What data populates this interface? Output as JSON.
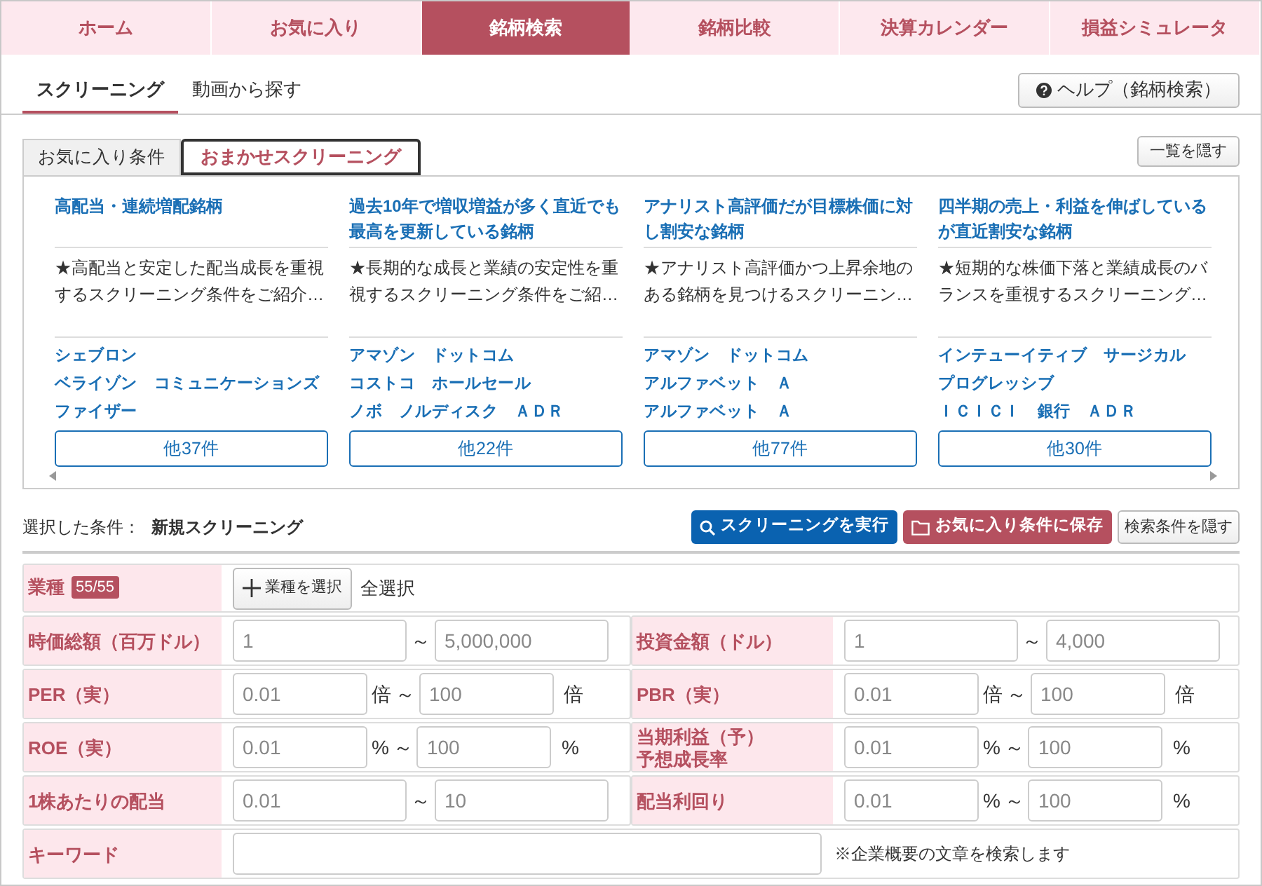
{
  "nav": [
    {
      "label": "ホーム",
      "selected": false
    },
    {
      "label": "お気に入り",
      "selected": false
    },
    {
      "label": "銘柄検索",
      "selected": true
    },
    {
      "label": "銘柄比較",
      "selected": false
    },
    {
      "label": "決算カレンダー",
      "selected": false
    },
    {
      "label": "損益シミュレータ",
      "selected": false
    }
  ],
  "subtabs": [
    {
      "label": "スクリーニング",
      "selected": true
    },
    {
      "label": "動画から探す",
      "selected": false
    }
  ],
  "help_button": "ヘルプ（銘柄検索）",
  "preset_tabs": [
    {
      "label": "お気に入り条件",
      "selected": false
    },
    {
      "label": "おまかせスクリーニング",
      "selected": true
    }
  ],
  "hide_list_button": "一覧を隠す",
  "presets": [
    {
      "title": "高配当・連続増配銘柄",
      "description": "★高配当と安定した配当成長を重視するスクリーニング条件をご紹介…",
      "stocks": [
        "シェブロン",
        "ベライゾン　コミュニケーションズ",
        "ファイザー"
      ],
      "more": "他37件"
    },
    {
      "title": "過去10年で増収増益が多く直近でも最高を更新している銘柄",
      "description": "★長期的な成長と業績の安定性を重視するスクリーニング条件をご紹…",
      "stocks": [
        "アマゾン　ドットコム",
        "コストコ　ホールセール",
        "ノボ　ノルディスク　ＡＤＲ"
      ],
      "more": "他22件"
    },
    {
      "title": "アナリスト高評価だが目標株価に対し割安な銘柄",
      "description": "★アナリスト高評価かつ上昇余地のある銘柄を見つけるスクリーニン…",
      "stocks": [
        "アマゾン　ドットコム",
        "アルファベット　Ａ",
        "アルファベット　Ａ"
      ],
      "more": "他77件"
    },
    {
      "title": "四半期の売上・利益を伸ばしているが直近割安な銘柄",
      "description": "★短期的な株価下落と業績成長のバランスを重視するスクリーニング…",
      "stocks": [
        "インテューイティブ　サージカル",
        "プログレッシブ",
        "ＩＣＩＣＩ　銀行　ＡＤＲ"
      ],
      "more": "他30件"
    }
  ],
  "selected_condition": {
    "label": "選択した条件：",
    "value": "新規スクリーニング"
  },
  "actions": [
    {
      "kind": "primary",
      "label": "スクリーニングを実行"
    },
    {
      "kind": "save",
      "label": "お気に入り条件に保存"
    },
    {
      "kind": "plain",
      "label": "検索条件を隠す"
    }
  ],
  "industry": {
    "label": "業種",
    "badge": "55/55",
    "button": "業種を選択",
    "note": "全選択"
  },
  "rows": [
    [
      {
        "kind": "range",
        "label": "時価総額（百万ドル）",
        "min": "1",
        "separator": "～",
        "max": "5,000,000"
      },
      {
        "kind": "range",
        "label": "投資金額（ドル）",
        "min": "1",
        "separator": "～",
        "max": "4,000"
      }
    ],
    [
      {
        "kind": "range",
        "label": "PER（実）",
        "min": "0.01",
        "separator": "～",
        "max": "100",
        "units": [
          "倍",
          "倍"
        ]
      },
      {
        "kind": "range",
        "label": "PBR（実）",
        "min": "0.01",
        "separator": "～",
        "max": "100",
        "units": [
          "倍",
          "倍"
        ]
      }
    ],
    [
      {
        "kind": "range",
        "label": "ROE（実）",
        "min": "0.01",
        "separator": "～",
        "max": "100",
        "units": [
          "%",
          "%"
        ]
      },
      {
        "kind": "range",
        "label": "当期利益（予）",
        "label_2": "予想成長率",
        "min": "0.01",
        "separator": "～",
        "max": "100",
        "units": [
          "%",
          "%"
        ]
      }
    ],
    [
      {
        "kind": "range",
        "label": "1株あたりの配当",
        "min": "0.01",
        "separator": "～",
        "max": "10"
      },
      {
        "kind": "range",
        "label": "配当利回り",
        "min": "0.01",
        "separator": "～",
        "max": "100",
        "units": [
          "%",
          "%"
        ]
      }
    ],
    [
      {
        "kind": "text",
        "label": "キーワード",
        "note": "※企業概要の文章を検索します"
      }
    ]
  ]
}
